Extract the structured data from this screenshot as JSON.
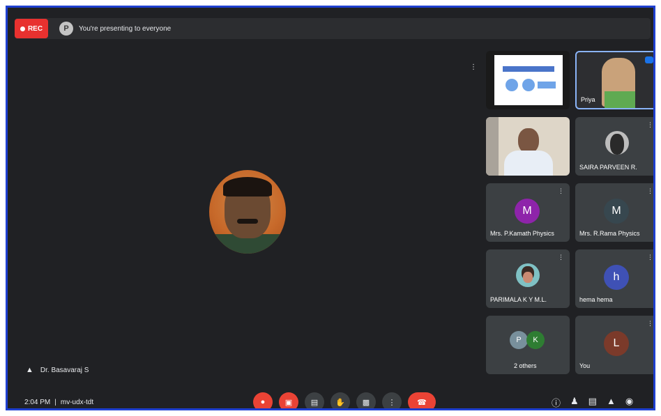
{
  "topbar": {
    "rec_label": "REC",
    "presenting_text": "You're presenting to everyone"
  },
  "main": {
    "speaker_name": "Dr. Basavaraj S"
  },
  "footer": {
    "time": "2:04 PM",
    "separator": "|",
    "meeting_code": "mv-udx-tdt"
  },
  "tiles": [
    {
      "name": "",
      "kind": "screen"
    },
    {
      "name": "Priya",
      "kind": "video"
    },
    {
      "name": "",
      "kind": "video"
    },
    {
      "name": "SAIRA PARVEEN R.",
      "kind": "avatar"
    },
    {
      "name": "Mrs. P.Kamath Physics",
      "initial": "M",
      "color": "#8e24aa"
    },
    {
      "name": "Mrs. R.Rama Physics",
      "initial": "M",
      "color": "#37474f"
    },
    {
      "name": "PARIMALA K Y M.L.",
      "kind": "avatar"
    },
    {
      "name": "hema hema",
      "initial": "h",
      "color": "#3f51b5"
    },
    {
      "name": "2 others",
      "initials": [
        "P",
        "K"
      ]
    },
    {
      "name": "You",
      "initial": "L",
      "color": "#7b3a2a"
    }
  ],
  "icons": {
    "pin": "pin-icon",
    "mic_off": "mic-off-icon",
    "camera_off": "camera-off-icon",
    "captions": "captions-icon",
    "hand": "raise-hand-icon",
    "present": "present-icon",
    "more": "more-options-icon",
    "end_call": "end-call-icon",
    "info": "info-icon",
    "people": "people-icon",
    "chat": "chat-icon",
    "activities": "activities-icon",
    "security": "host-controls-icon"
  },
  "colors": {
    "background": "#202124",
    "accent_red": "#ea4335",
    "frame_border": "#1e3fcf"
  }
}
